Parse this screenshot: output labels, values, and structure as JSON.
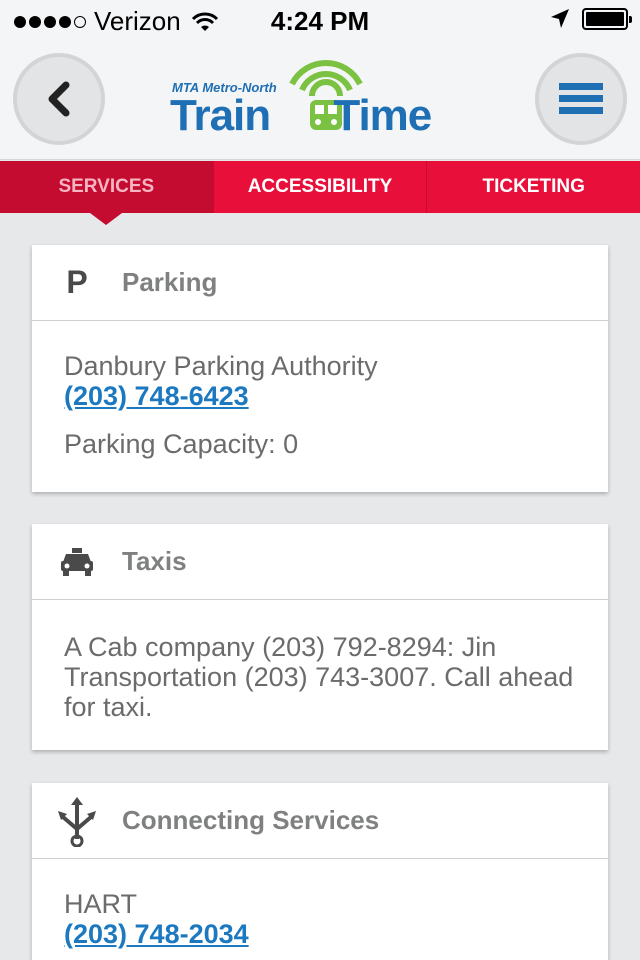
{
  "status": {
    "carrier": "Verizon",
    "time": "4:24 PM",
    "signal_dots_filled": 4,
    "signal_dots_total": 5,
    "battery_level": 1.0
  },
  "header": {
    "logo_sub": "MTA Metro-North",
    "logo_main": "Train Time",
    "brand_color": "#1f6fb5",
    "accent_color": "#7cc242"
  },
  "tabs": [
    {
      "label": "SERVICES",
      "active": true
    },
    {
      "label": "ACCESSIBILITY",
      "active": false
    },
    {
      "label": "TICKETING",
      "active": false
    }
  ],
  "cards": {
    "parking": {
      "title": "Parking",
      "icon_letter": "P",
      "authority": "Danbury Parking Authority",
      "phone": "(203) 748-6423",
      "capacity": "Parking Capacity: 0"
    },
    "taxis": {
      "title": "Taxis",
      "text": "A Cab company (203) 792-8294: Jin Transportation (203) 743-3007. Call ahead for taxi."
    },
    "connecting": {
      "title": "Connecting Services",
      "name": "HART",
      "phone": "(203) 748-2034"
    }
  },
  "colors": {
    "tab_bar": "#e8103a",
    "tab_active": "#c40c30",
    "link": "#1c79c0"
  }
}
